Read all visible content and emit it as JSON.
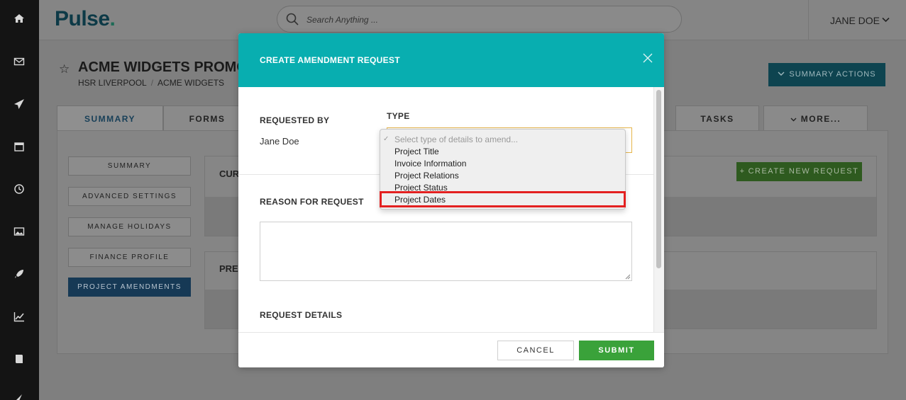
{
  "sidebar": {
    "icons": [
      "home-icon",
      "mail-icon",
      "send-icon",
      "calendar-icon",
      "clock-icon",
      "image-icon",
      "rocket-icon",
      "chart-icon",
      "book-icon",
      "pin-icon"
    ]
  },
  "header": {
    "logo_text": "Pulse",
    "logo_dot": ".",
    "search_placeholder": "Search Anything ...",
    "user_name": "JANE DOE"
  },
  "project": {
    "title": "ACME WIDGETS PROMO",
    "breadcrumb": [
      "HSR LIVERPOOL",
      "ACME WIDGETS"
    ],
    "summary_actions_label": "SUMMARY ACTIONS"
  },
  "tabs": [
    {
      "label": "SUMMARY"
    },
    {
      "label": "FORMS"
    },
    {
      "label": "TASKS"
    },
    {
      "label": "MORE..."
    }
  ],
  "side_nav": [
    {
      "label": "SUMMARY"
    },
    {
      "label": "ADVANCED SETTINGS"
    },
    {
      "label": "MANAGE HOLIDAYS"
    },
    {
      "label": "FINANCE PROFILE"
    },
    {
      "label": "PROJECT AMENDMENTS"
    }
  ],
  "panels": {
    "current_prefix": "CUR",
    "previous_prefix": "PREV",
    "create_new_request": "CREATE NEW REQUEST"
  },
  "modal": {
    "title": "CREATE AMENDMENT REQUEST",
    "requested_by_label": "REQUESTED BY",
    "requested_by_value": "Jane Doe",
    "type_label": "TYPE",
    "type_options": [
      "Select type of details to amend...",
      "Project Title",
      "Invoice Information",
      "Project Relations",
      "Project Status",
      "Project Dates"
    ],
    "highlighted_option": "Project Dates",
    "reason_label": "REASON FOR REQUEST",
    "request_details_label": "REQUEST DETAILS",
    "cancel_label": "CANCEL",
    "submit_label": "SUBMIT"
  },
  "colors": {
    "modal_header": "#08aeb0",
    "submit": "#3aa23a",
    "highlight": "#e32020",
    "select_border": "#e6b54a"
  }
}
